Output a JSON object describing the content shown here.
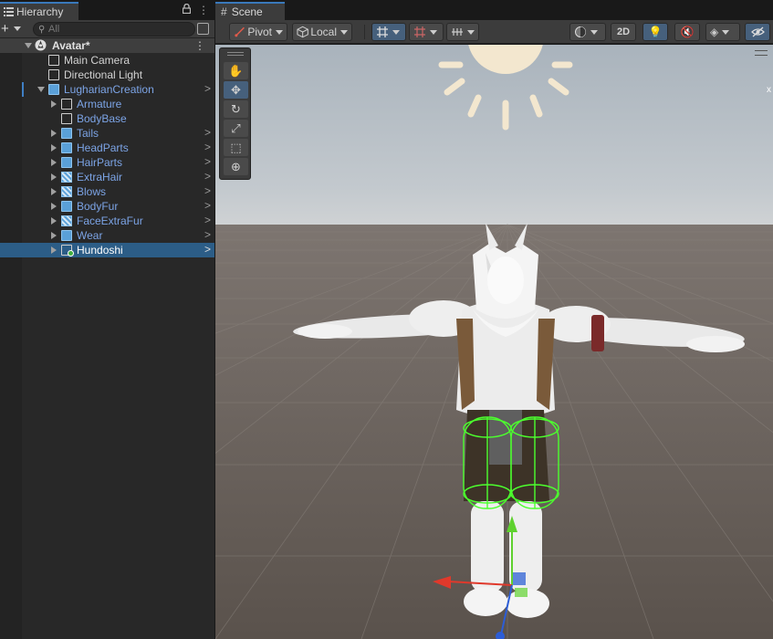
{
  "hierarchy": {
    "tab_label": "Hierarchy",
    "search_placeholder": "All",
    "scene_name": "Avatar*",
    "items": [
      {
        "label": "Main Camera",
        "style": "normal"
      },
      {
        "label": "Directional Light",
        "style": "normal"
      },
      {
        "label": "LugharianCreation",
        "style": "prefab"
      },
      {
        "label": "Armature",
        "style": "prefab"
      },
      {
        "label": "BodyBase",
        "style": "prefab"
      },
      {
        "label": "Tails",
        "style": "prefab"
      },
      {
        "label": "HeadParts",
        "style": "prefab"
      },
      {
        "label": "HairParts",
        "style": "prefab"
      },
      {
        "label": "ExtraHair",
        "style": "prefab"
      },
      {
        "label": "Blows",
        "style": "prefab"
      },
      {
        "label": "BodyFur",
        "style": "prefab"
      },
      {
        "label": "FaceExtraFur",
        "style": "prefab"
      },
      {
        "label": "Wear",
        "style": "prefab"
      },
      {
        "label": "Hundoshi",
        "style": "selected"
      }
    ]
  },
  "scene": {
    "tab_label": "Scene",
    "toolbar": {
      "pivot_label": "Pivot",
      "local_label": "Local",
      "mode_2d_label": "2D"
    },
    "axis_label": "x"
  },
  "icons": {
    "hierarchy_tab": "list-icon",
    "scene_tab": "grid-hash-icon",
    "lock": "lock-icon",
    "search": "search-icon"
  },
  "colors": {
    "accent": "#3a79bb",
    "selection": "#2c5d87",
    "prefab_text": "#7ca4e6",
    "collider_green": "#4cff2e"
  }
}
